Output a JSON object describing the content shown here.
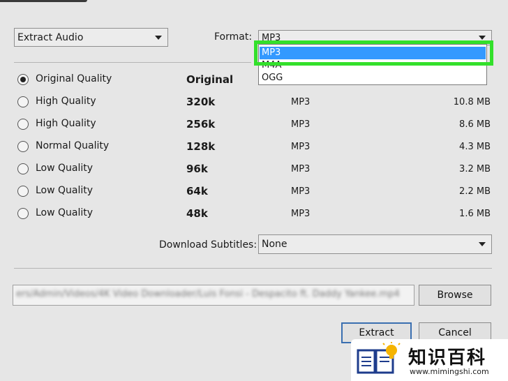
{
  "mode": {
    "value": "Extract Audio"
  },
  "format": {
    "label": "Format:",
    "value": "MP3",
    "options": [
      "MP3",
      "M4A",
      "OGG"
    ],
    "selected": "MP3"
  },
  "quality_options": [
    {
      "label": "Original Quality",
      "bitrate": "Original",
      "format": "",
      "size": "",
      "checked": true
    },
    {
      "label": "High Quality",
      "bitrate": "320k",
      "format": "MP3",
      "size": "10.8 MB",
      "checked": false
    },
    {
      "label": "High Quality",
      "bitrate": "256k",
      "format": "MP3",
      "size": "8.6 MB",
      "checked": false
    },
    {
      "label": "Normal Quality",
      "bitrate": "128k",
      "format": "MP3",
      "size": "4.3 MB",
      "checked": false
    },
    {
      "label": "Low Quality",
      "bitrate": "96k",
      "format": "MP3",
      "size": "3.2 MB",
      "checked": false
    },
    {
      "label": "Low Quality",
      "bitrate": "64k",
      "format": "MP3",
      "size": "2.2 MB",
      "checked": false
    },
    {
      "label": "Low Quality",
      "bitrate": "48k",
      "format": "MP3",
      "size": "1.6 MB",
      "checked": false
    }
  ],
  "subtitles": {
    "label": "Download Subtitles:",
    "value": "None"
  },
  "path": {
    "value": "ers/Admin/Videos/4K Video Downloader/Luis Fonsi - Despacito ft. Daddy Yankee.mp4"
  },
  "buttons": {
    "browse": "Browse",
    "extract": "Extract",
    "cancel": "Cancel"
  },
  "watermark": {
    "title": "知识百科",
    "url": "www.mimingshi.com"
  },
  "colors": {
    "highlight": "#33e02b",
    "selection": "#3399ff",
    "background": "#e6e6e6"
  }
}
